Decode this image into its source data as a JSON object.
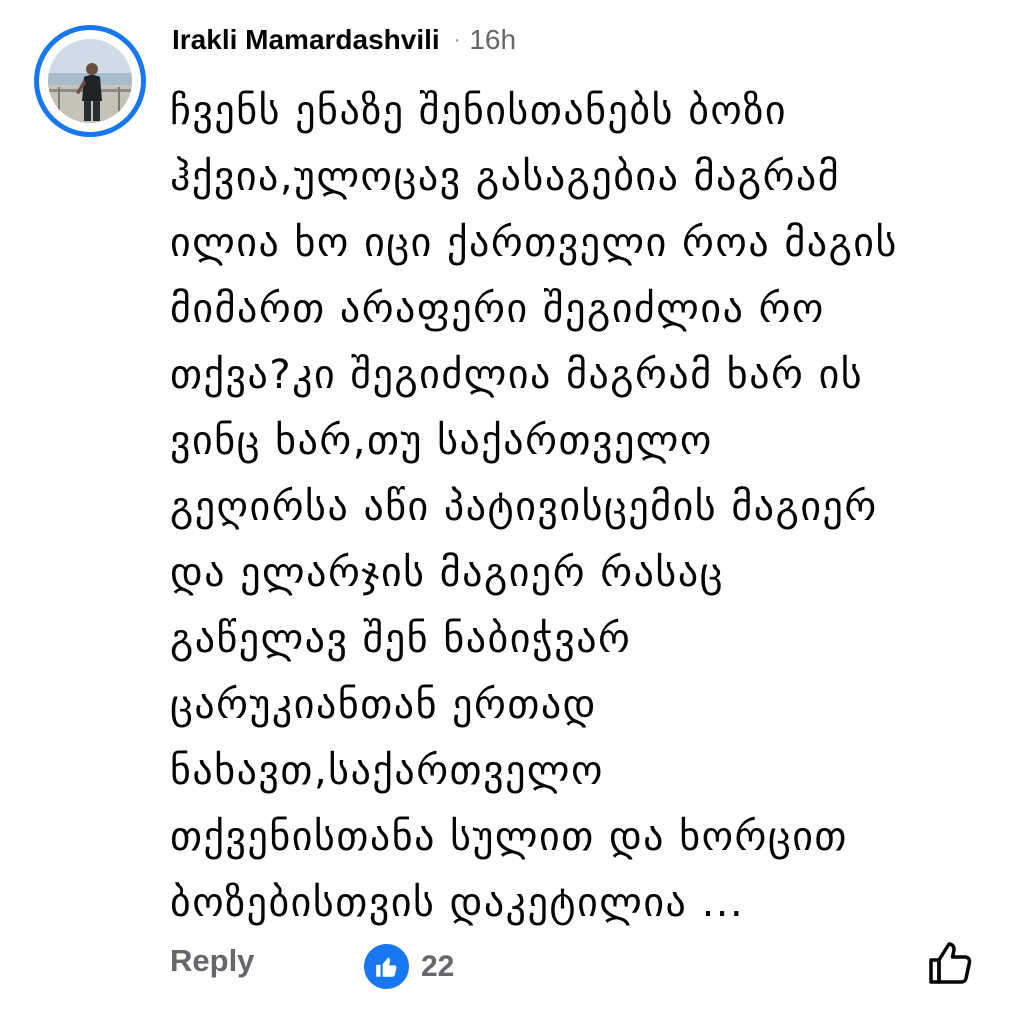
{
  "comment": {
    "author": "Irakli Mamardashvili",
    "separator": "·",
    "time": "16h",
    "lines": [
      "ჩვენს ენაზე შენისთანებს ბოზი",
      "ჰქვია,ულოცავ გასაგებია მაგრამ",
      "ილია ხო იცი ქართველი როა მაგის",
      "მიმართ არაფერი შეგიძლია რო",
      "თქვა?კი შეგიძლია მაგრამ ხარ ის",
      "ვინც ხარ,თუ საქართველო",
      "გეღირსა აწი პატივისცემის მაგიერ",
      "და ელარჯის მაგიერ რასაც",
      "გაწელავ შენ ნაბიჭვარ",
      "ცარუკიანთან ერთად",
      "ნახავთ,საქართველო",
      "თქვენისთანა სულით და ხორცით",
      "ბოზებისთვის დაკეტილია ..."
    ]
  },
  "actions": {
    "reply_label": "Reply",
    "reaction_count": "22",
    "reaction_icon": "like-thumb-icon",
    "like_icon": "thumb-up-outline-icon"
  },
  "colors": {
    "accent": "#1877f2",
    "text": "#050505",
    "secondary": "#65676b"
  }
}
